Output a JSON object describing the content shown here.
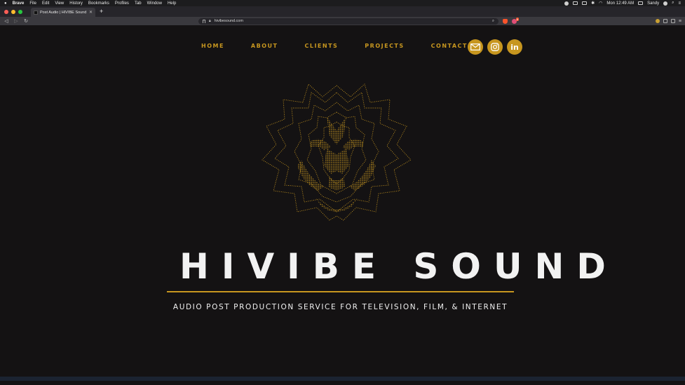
{
  "os_menubar": {
    "app_name": "Brave",
    "items": [
      "File",
      "Edit",
      "View",
      "History",
      "Bookmarks",
      "Profiles",
      "Tab",
      "Window",
      "Help"
    ],
    "clock": "Mon 12:49 AM",
    "user": "Sandy"
  },
  "browser": {
    "tab_title": "Post Audio | HIVIBE Sound | Lo",
    "url": "hivibesound.com",
    "shield_badge": "8"
  },
  "site": {
    "nav": [
      {
        "label": "HOME"
      },
      {
        "label": "ABOUT"
      },
      {
        "label": "CLIENTS"
      },
      {
        "label": "PROJECTS"
      },
      {
        "label": "CONTACT"
      }
    ],
    "social": {
      "email_icon": "envelope-icon",
      "instagram_icon": "instagram-icon",
      "linkedin_label": "in"
    },
    "logo_icon": "lion-head-icon",
    "hero_title": "HIVIBE SOUND",
    "hero_subtitle": "AUDIO POST PRODUCTION SERVICE FOR TELEVISION, FILM, & INTERNET",
    "colors": {
      "background": "#141213",
      "accent_gold": "#c7961f",
      "text_light": "#f2f2f2"
    }
  }
}
